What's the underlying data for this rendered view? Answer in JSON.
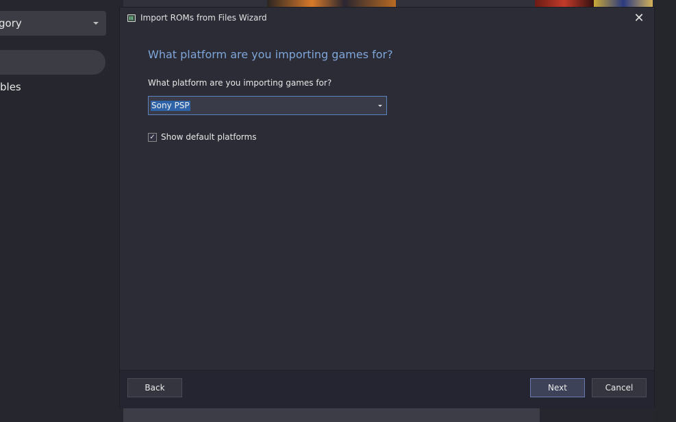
{
  "background": {
    "category_label": "gory",
    "consoles_label": "bles"
  },
  "dialog": {
    "title": "Import ROMs from Files Wizard",
    "close_glyph": "✕",
    "heading": "What platform are you importing games for?",
    "field_label": "What platform are you importing games for?",
    "platform_selected": "Sony PSP",
    "show_default_platforms_label": "Show default platforms",
    "show_default_platforms_checked": true,
    "check_glyph": "✓",
    "buttons": {
      "back": "Back",
      "next": "Next",
      "cancel": "Cancel"
    }
  },
  "colors": {
    "heading_accent": "#7fa6d9",
    "selection_highlight": "#2f63a8",
    "dialog_background": "#2b2c36"
  },
  "icons": [
    "app-icon",
    "close-icon",
    "dropdown-arrow-icon",
    "check-icon"
  ]
}
